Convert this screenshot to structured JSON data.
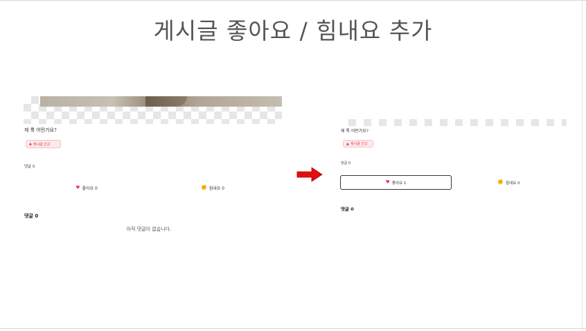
{
  "slide": {
    "title": "게시글 좋아요 / 힘내요 추가"
  },
  "before": {
    "post_title": "제 룩 어떤가요?",
    "report_label": "게시글 신고",
    "comment_count_label": "댓글 0",
    "like_label": "좋아요 0",
    "cheer_label": "힘내요 0",
    "comments_header": "댓글 0",
    "empty_message": "아직 댓글이 없습니다."
  },
  "after": {
    "post_title": "제 룩 어떤가요?",
    "report_label": "게시글 신고",
    "comment_count_label": "댓글 0",
    "like_label": "좋아요 1",
    "like_active": true,
    "cheer_label": "힘내요 0",
    "comments_header": "댓글 0"
  },
  "icons": {
    "heart": "heart-icon",
    "muscle": "flexed-biceps-icon",
    "siren": "siren-icon",
    "arrow": "right-arrow-icon"
  },
  "colors": {
    "arrow": "#e01010",
    "heart": "#e0455a",
    "report_bg": "#fde8ea",
    "report_text": "#d9364a"
  }
}
